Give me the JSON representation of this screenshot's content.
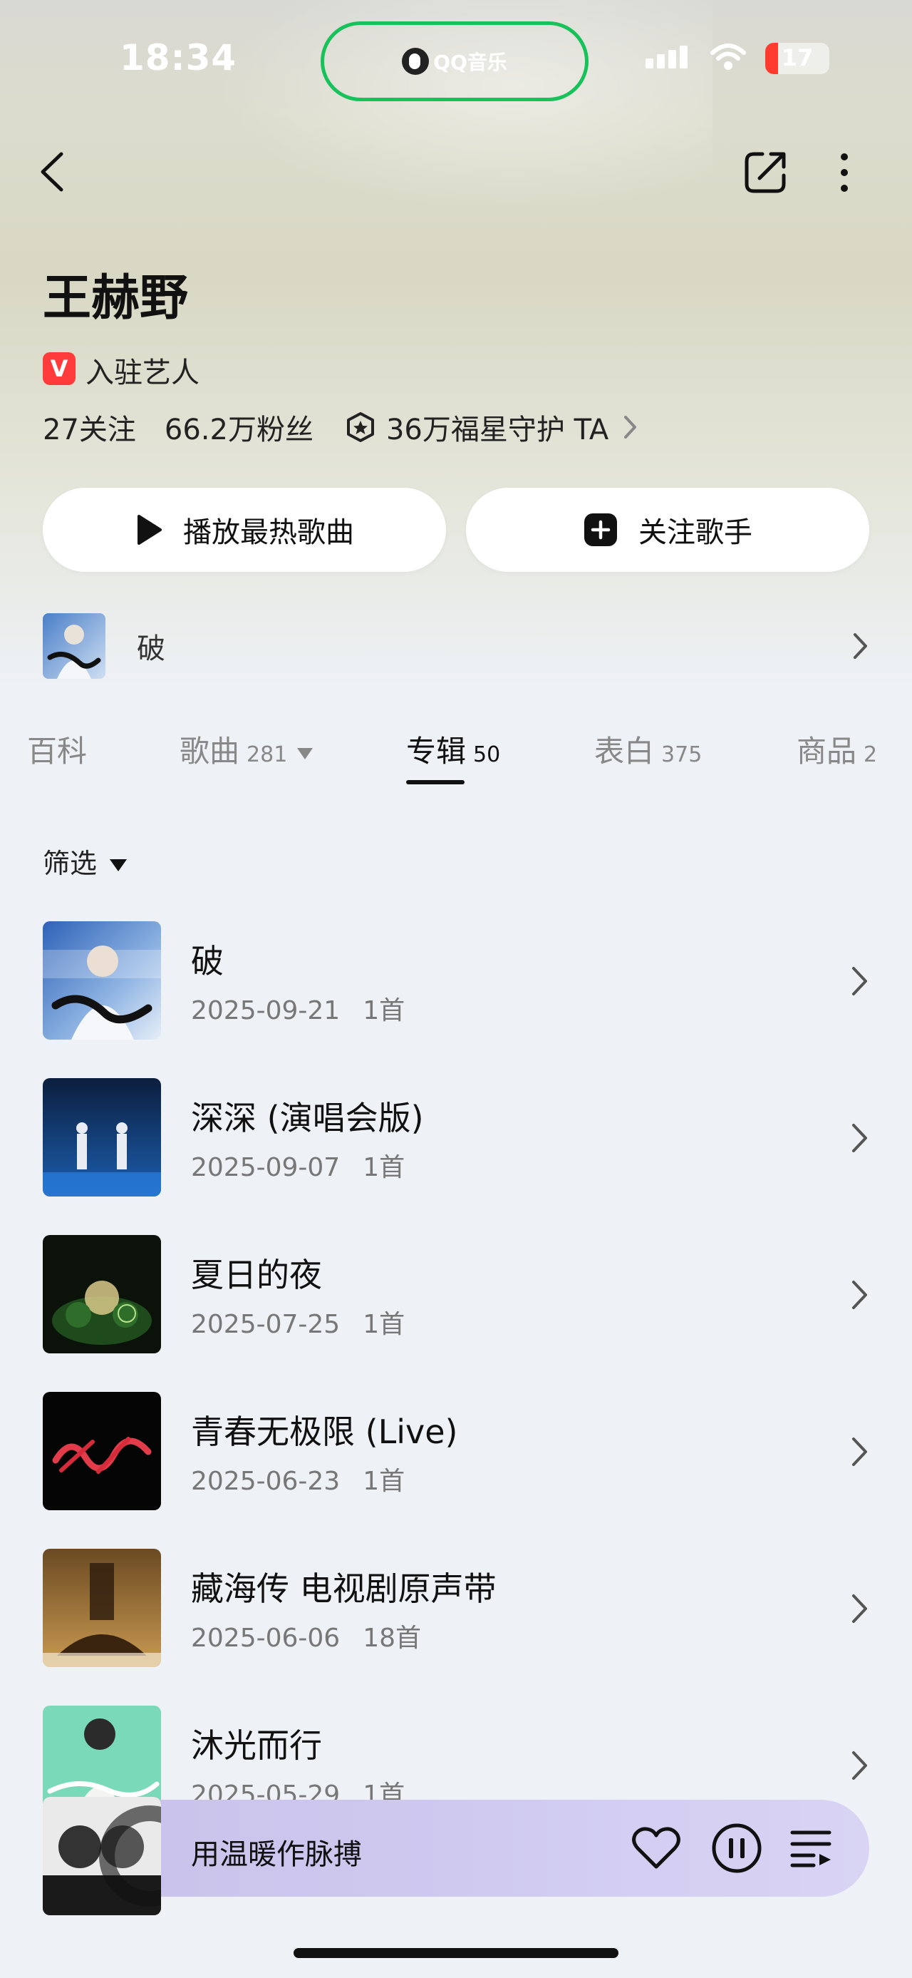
{
  "status_bar": {
    "time": "18:34",
    "island_label": "QQ音乐",
    "battery": "17"
  },
  "artist": {
    "name": "王赫野",
    "verified_badge": "V",
    "verified_label": "入驻艺人",
    "following": "27关注",
    "fans": "66.2万粉丝",
    "guardians": "36万福星守护 TA"
  },
  "buttons": {
    "play_hot": "播放最热歌曲",
    "follow": "关注歌手"
  },
  "latest": {
    "title": "破"
  },
  "tabs": [
    {
      "label": "百科",
      "count": ""
    },
    {
      "label": "歌曲",
      "count": "281"
    },
    {
      "label": "专辑",
      "count": "50"
    },
    {
      "label": "表白",
      "count": "375"
    },
    {
      "label": "商品",
      "count": "2"
    }
  ],
  "filter": {
    "label": "筛选"
  },
  "albums": [
    {
      "title": "破",
      "date": "2025-09-21",
      "tracks": "1首"
    },
    {
      "title": "深深 (演唱会版)",
      "date": "2025-09-07",
      "tracks": "1首"
    },
    {
      "title": "夏日的夜",
      "date": "2025-07-25",
      "tracks": "1首"
    },
    {
      "title": "青春无极限 (Live)",
      "date": "2025-06-23",
      "tracks": "1首"
    },
    {
      "title": "藏海传 电视剧原声带",
      "date": "2025-06-06",
      "tracks": "18首"
    },
    {
      "title": "沐光而行",
      "date": "2025-05-29",
      "tracks": "1首"
    }
  ],
  "player": {
    "now_playing": "用温暖作脉搏"
  },
  "colors": {
    "accent_green": "#18c25a",
    "badge_red": "#ff3b3b",
    "player_bg": "#cfc9f0"
  }
}
